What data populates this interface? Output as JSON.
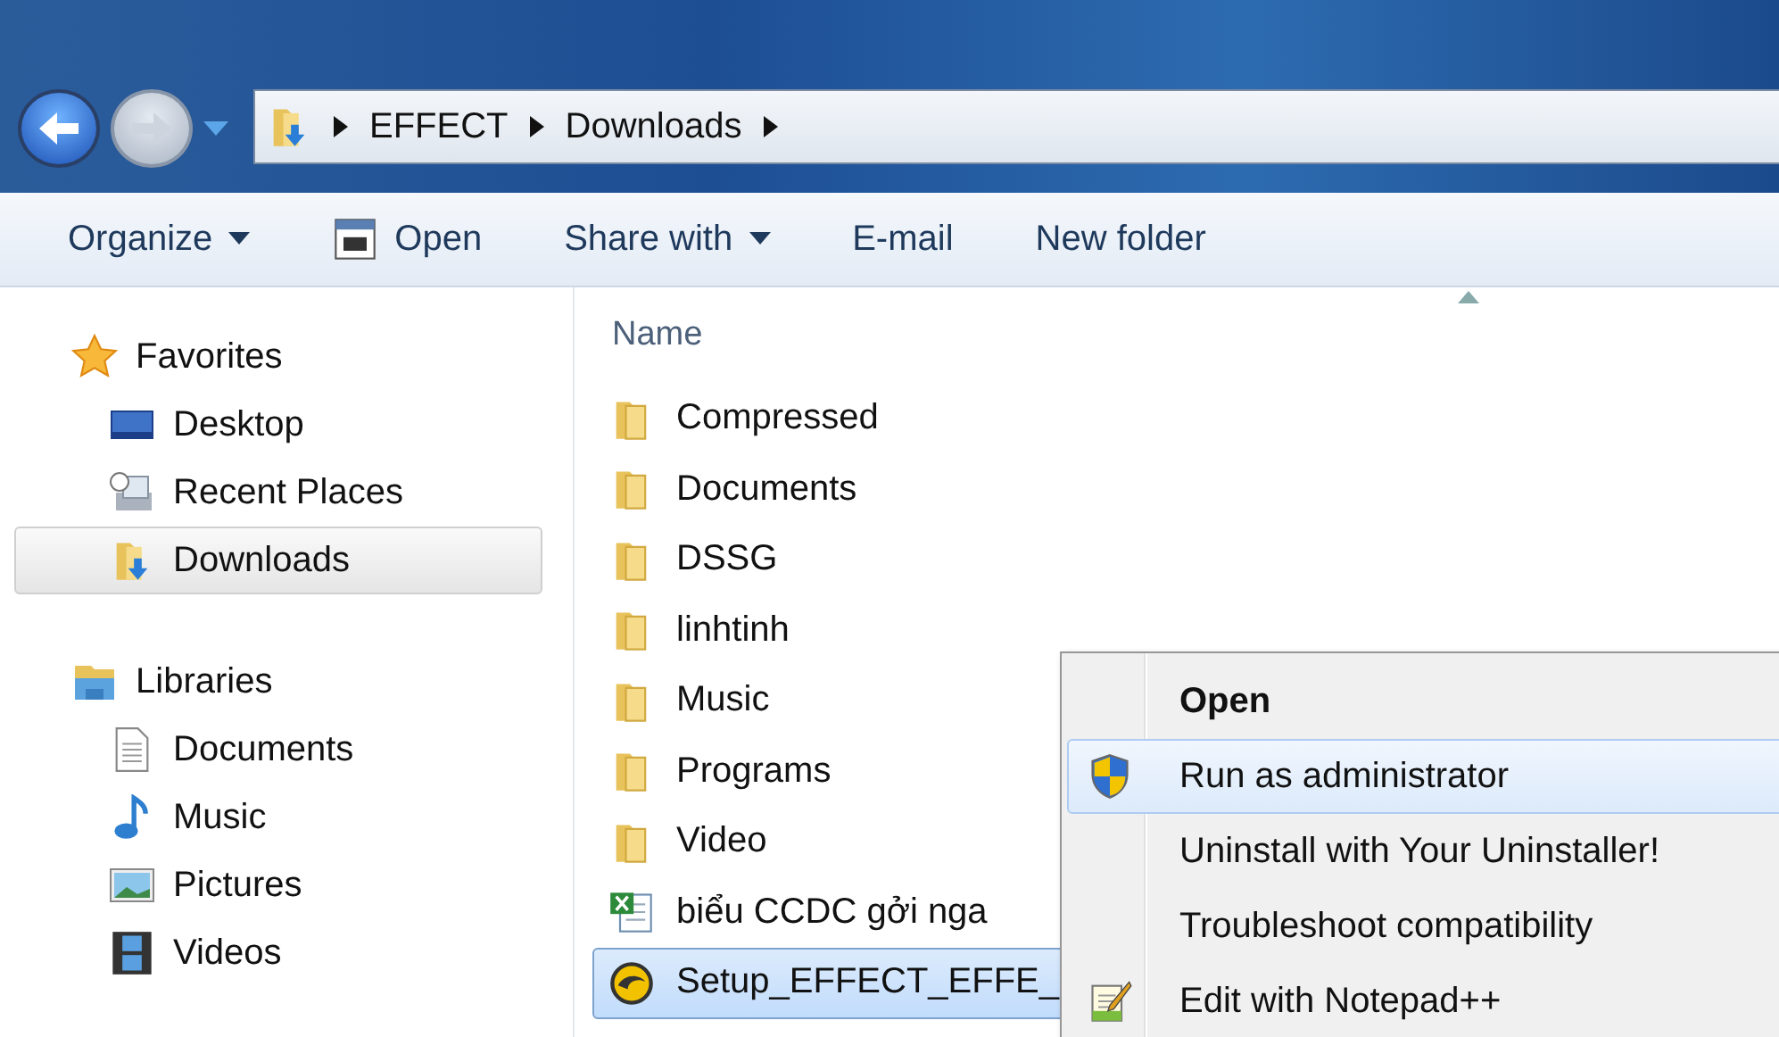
{
  "address_bar": {
    "crumbs": [
      "EFFECT",
      "Downloads"
    ]
  },
  "toolbar": [
    {
      "label": "Organize",
      "kind": "dropdown"
    },
    {
      "label": "Open",
      "kind": "open"
    },
    {
      "label": "Share with",
      "kind": "dropdown"
    },
    {
      "label": "E-mail",
      "kind": "plain"
    },
    {
      "label": "New folder",
      "kind": "plain"
    }
  ],
  "sidebar": {
    "groups": [
      {
        "label": "Favorites",
        "kind": "star",
        "items": [
          {
            "label": "Desktop",
            "kind": "desktop",
            "selected": false
          },
          {
            "label": "Recent Places",
            "kind": "recent",
            "selected": false
          },
          {
            "label": "Downloads",
            "kind": "downloads",
            "selected": true
          }
        ]
      },
      {
        "label": "Libraries",
        "kind": "library",
        "items": [
          {
            "label": "Documents",
            "kind": "document",
            "selected": false
          },
          {
            "label": "Music",
            "kind": "music",
            "selected": false
          },
          {
            "label": "Pictures",
            "kind": "pictures",
            "selected": false
          },
          {
            "label": "Videos",
            "kind": "videos",
            "selected": false
          }
        ]
      }
    ]
  },
  "file_list": {
    "columns": [
      "Name"
    ],
    "rows": [
      {
        "name": "Compressed",
        "kind": "folder",
        "selected": false
      },
      {
        "name": "Documents",
        "kind": "folder",
        "selected": false
      },
      {
        "name": "DSSG",
        "kind": "folder",
        "selected": false
      },
      {
        "name": "linhtinh",
        "kind": "folder",
        "selected": false
      },
      {
        "name": "Music",
        "kind": "folder",
        "selected": false
      },
      {
        "name": "Programs",
        "kind": "folder",
        "selected": false
      },
      {
        "name": "Video",
        "kind": "folder",
        "selected": false
      },
      {
        "name": "biểu CCDC gởi nga",
        "kind": "excel",
        "selected": false
      },
      {
        "name": "Setup_EFFECT_EFFE_",
        "kind": "setup",
        "selected": true
      }
    ]
  },
  "context_menu": [
    {
      "label": "Open",
      "kind": "default",
      "selected": false
    },
    {
      "label": "Run as administrator",
      "kind": "shield",
      "selected": true
    },
    {
      "label": "Uninstall with Your Uninstaller!",
      "kind": "plain",
      "selected": false
    },
    {
      "label": "Troubleshoot compatibility",
      "kind": "plain",
      "selected": false
    },
    {
      "label": "Edit with Notepad++",
      "kind": "notepad",
      "selected": false
    }
  ]
}
